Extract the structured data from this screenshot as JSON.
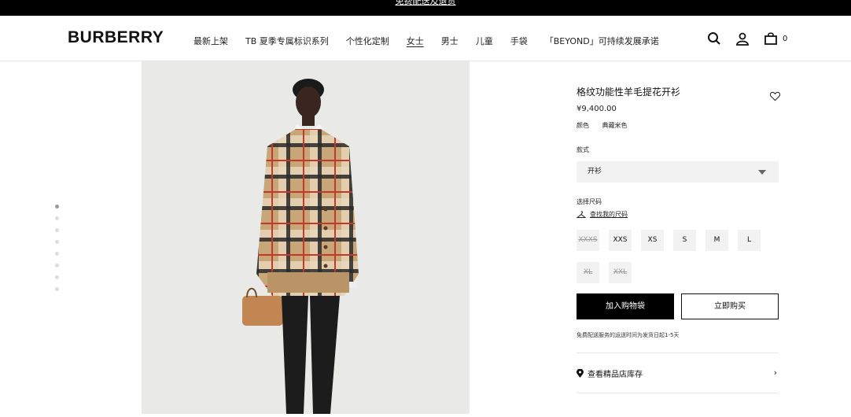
{
  "promo": {
    "text": "免费配送及退货"
  },
  "header": {
    "logo": "BURBERRY",
    "nav": [
      {
        "label": "最新上架"
      },
      {
        "label": "TB 夏季专属标识系列"
      },
      {
        "label": "个性化定制"
      },
      {
        "label": "女士"
      },
      {
        "label": "男士"
      },
      {
        "label": "儿童"
      },
      {
        "label": "手袋"
      },
      {
        "label": "「BEYOND」可持续发展承诺"
      }
    ],
    "active_nav": "女士",
    "icons": [
      "search-icon",
      "account-icon",
      "bag-icon"
    ],
    "bag_count": "0"
  },
  "gallery": {
    "image_alt": "product-model-image",
    "dots_count": 8,
    "active_dot": 0
  },
  "product": {
    "title": "格纹功能性羊毛提花开衫",
    "price": "¥9,400.00",
    "color_label": "颜色",
    "color_value": "典藏米色",
    "style_label": "款式",
    "style_value": "开衫",
    "size_label": "选择尺码",
    "size_guide": "查找我的尺码",
    "sizes": [
      {
        "label": "XXXS",
        "available": false
      },
      {
        "label": "XXS",
        "available": true
      },
      {
        "label": "XS",
        "available": true
      },
      {
        "label": "S",
        "available": true
      },
      {
        "label": "M",
        "available": true
      },
      {
        "label": "L",
        "available": true
      },
      {
        "label": "XL",
        "available": false
      },
      {
        "label": "XXL",
        "available": false
      }
    ],
    "add_to_bag": "加入购物袋",
    "buy_now": "立即购买",
    "shipping_note": "免费配送服务的运送时间为发货日起1-5天",
    "store_stock": "查看精品店库存"
  }
}
